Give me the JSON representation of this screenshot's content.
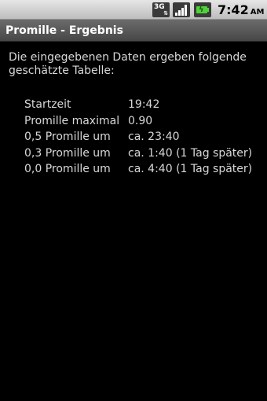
{
  "status_bar": {
    "network_label": "3G",
    "network_arrows": "⇅",
    "signal_icon": "signal-bars-icon",
    "battery_icon": "battery-charging-icon",
    "time": "7:42",
    "ampm": "AM"
  },
  "title_bar": {
    "title": "Promille - Ergebnis"
  },
  "content": {
    "intro": "Die eingegebenen Daten ergeben folgende geschätzte Tabelle:",
    "rows": [
      {
        "label": "Startzeit",
        "value": "19:42"
      },
      {
        "label": "Promille maximal",
        "value": "0.90"
      },
      {
        "label": "0,5 Promille um",
        "value": "ca. 23:40"
      },
      {
        "label": "0,3 Promille um",
        "value": "ca. 1:40 (1 Tag später)"
      },
      {
        "label": "0,0 Promille um",
        "value": "ca. 4:40 (1 Tag später)"
      }
    ]
  },
  "colors": {
    "background": "#000000",
    "text": "#d8d8d8",
    "title_bar": "#595959",
    "battery": "#4fd13a"
  }
}
